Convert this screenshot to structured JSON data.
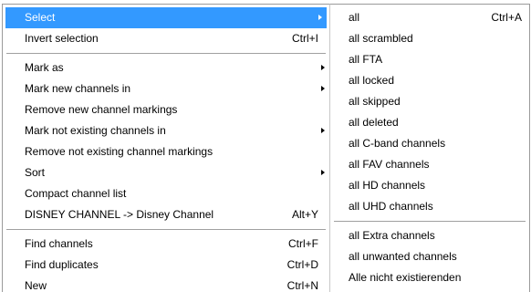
{
  "colors": {
    "highlight": "#3399ff",
    "highlight_text": "#ffffff",
    "separator": "#a0a0a0"
  },
  "main_menu": {
    "groups": [
      [
        {
          "label": "Select",
          "shortcut": "",
          "submenu": true,
          "highlighted": true
        },
        {
          "label": "Invert selection",
          "shortcut": "Ctrl+I",
          "submenu": false,
          "highlighted": false
        }
      ],
      [
        {
          "label": "Mark as",
          "shortcut": "",
          "submenu": true,
          "highlighted": false
        },
        {
          "label": "Mark new channels in",
          "shortcut": "",
          "submenu": true,
          "highlighted": false
        },
        {
          "label": "Remove new channel markings",
          "shortcut": "",
          "submenu": false,
          "highlighted": false
        },
        {
          "label": "Mark not existing channels in",
          "shortcut": "",
          "submenu": true,
          "highlighted": false
        },
        {
          "label": "Remove not existing channel markings",
          "shortcut": "",
          "submenu": false,
          "highlighted": false
        },
        {
          "label": "Sort",
          "shortcut": "",
          "submenu": true,
          "highlighted": false
        },
        {
          "label": "Compact channel list",
          "shortcut": "",
          "submenu": false,
          "highlighted": false
        },
        {
          "label": "DISNEY CHANNEL -> Disney Channel",
          "shortcut": "Alt+Y",
          "submenu": false,
          "highlighted": false
        }
      ],
      [
        {
          "label": "Find channels",
          "shortcut": "Ctrl+F",
          "submenu": false,
          "highlighted": false
        },
        {
          "label": "Find duplicates",
          "shortcut": "Ctrl+D",
          "submenu": false,
          "highlighted": false
        },
        {
          "label": "New",
          "shortcut": "Ctrl+N",
          "submenu": false,
          "highlighted": false
        }
      ]
    ]
  },
  "select_submenu": {
    "groups": [
      [
        {
          "label": "all",
          "shortcut": "Ctrl+A"
        },
        {
          "label": "all scrambled",
          "shortcut": ""
        },
        {
          "label": "all FTA",
          "shortcut": ""
        },
        {
          "label": "all locked",
          "shortcut": ""
        },
        {
          "label": "all skipped",
          "shortcut": ""
        },
        {
          "label": "all deleted",
          "shortcut": ""
        },
        {
          "label": "all C-band channels",
          "shortcut": ""
        },
        {
          "label": "all FAV channels",
          "shortcut": ""
        },
        {
          "label": "all HD channels",
          "shortcut": ""
        },
        {
          "label": "all UHD channels",
          "shortcut": ""
        }
      ],
      [
        {
          "label": "all Extra channels",
          "shortcut": ""
        },
        {
          "label": "all unwanted channels",
          "shortcut": ""
        },
        {
          "label": "Alle nicht existierenden",
          "shortcut": ""
        }
      ]
    ]
  }
}
